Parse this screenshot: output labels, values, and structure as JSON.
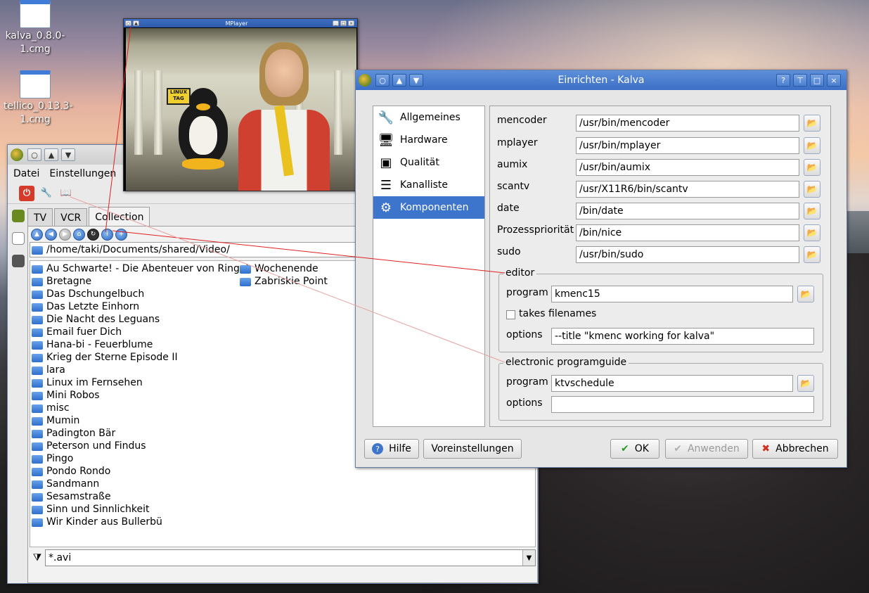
{
  "desktop": {
    "icons": [
      {
        "label": "kalva_0.8.0-1.cmg"
      },
      {
        "label": "tellico_0.13.3-1.cmg"
      }
    ]
  },
  "video_window": {
    "title": "MPlayer",
    "sign_text": "LINUX TAG"
  },
  "kalva_window": {
    "menu": [
      "Datei",
      "Einstellungen"
    ],
    "tabs": [
      "TV",
      "VCR",
      "Collection"
    ],
    "path": "/home/taki/Documents/shared/Video/",
    "folders_col1": [
      "Au Schwarte! - Die Abenteuer von Ringel,",
      "Bretagne",
      "Das Dschungelbuch",
      "Das Letzte Einhorn",
      "Die Nacht des Leguans",
      "Email fuer Dich",
      "Hana-bi - Feuerblume",
      "Krieg der Sterne Episode II",
      "lara",
      "Linux im Fernsehen",
      "Mini Robos",
      "misc",
      "Mumin",
      "Padington Bär",
      "Peterson und Findus",
      "Pingo",
      "Pondo Rondo",
      "Sandmann",
      "Sesamstraße",
      "Sinn und Sinnlichkeit",
      "Wir Kinder aus Bullerbü"
    ],
    "folders_col2": [
      "Wochenende",
      "Zabriskie Point"
    ],
    "filter": "*.avi"
  },
  "dialog": {
    "title": "Einrichten - Kalva",
    "categories": [
      {
        "label": "Allgemeines",
        "icon": "wrench-icon"
      },
      {
        "label": "Hardware",
        "icon": "monitor-icon"
      },
      {
        "label": "Qualität",
        "icon": "screen-icon"
      },
      {
        "label": "Kanalliste",
        "icon": "list-icon"
      },
      {
        "label": "Komponenten",
        "icon": "gear-icon",
        "selected": true
      }
    ],
    "components": [
      {
        "label": "mencoder",
        "value": "/usr/bin/mencoder"
      },
      {
        "label": "mplayer",
        "value": "/usr/bin/mplayer"
      },
      {
        "label": "aumix",
        "value": "/usr/bin/aumix"
      },
      {
        "label": "scantv",
        "value": "/usr/X11R6/bin/scantv"
      },
      {
        "label": "date",
        "value": "/bin/date"
      },
      {
        "label": "Prozesspriorität",
        "value": "/bin/nice"
      },
      {
        "label": "sudo",
        "value": "/usr/bin/sudo"
      }
    ],
    "editor": {
      "group_label": "editor",
      "program_label": "program",
      "program_value": "kmenc15",
      "takes_filenames_label": "takes filenames",
      "options_label": "options",
      "options_value": "--title \"kmenc working for kalva\""
    },
    "epg": {
      "group_label": "electronic programguide",
      "program_label": "program",
      "program_value": "ktvschedule",
      "options_label": "options",
      "options_value": ""
    },
    "buttons": {
      "help": "Hilfe",
      "defaults": "Voreinstellungen",
      "ok": "OK",
      "apply": "Anwenden",
      "cancel": "Abbrechen"
    }
  },
  "colors": {
    "accent": "#3d74cc",
    "annotation_line": "#e02020"
  }
}
